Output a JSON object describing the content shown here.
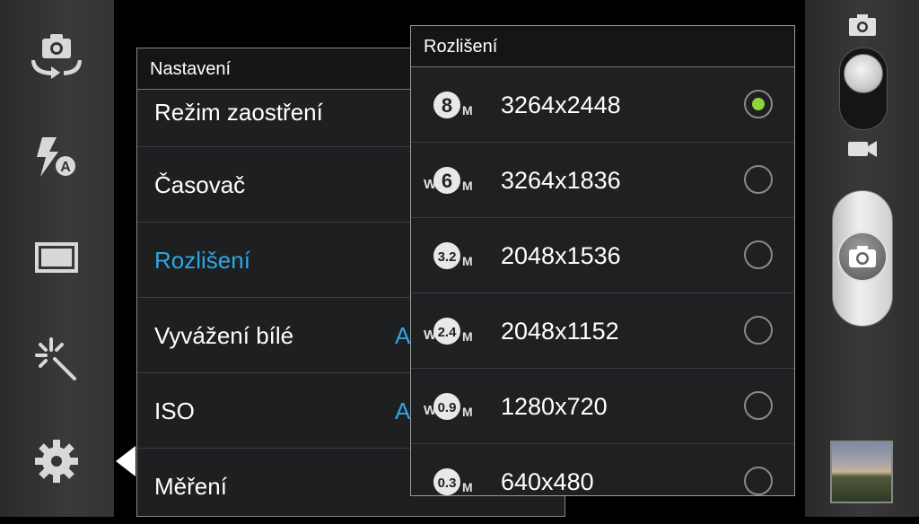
{
  "left_bar": {
    "icons": [
      "switch-camera-icon",
      "flash-auto-icon",
      "aspect-ratio-icon",
      "effects-icon",
      "gear-icon"
    ]
  },
  "settings": {
    "title": "Nastavení",
    "items": [
      {
        "label": "Režim zaostření",
        "value": ""
      },
      {
        "label": "Časovač",
        "value": ""
      },
      {
        "label": "Rozlišení",
        "value": ""
      },
      {
        "label": "Vyvážení bílé",
        "value": "A"
      },
      {
        "label": "ISO",
        "value": "A"
      },
      {
        "label": "Měření",
        "value": ""
      }
    ]
  },
  "resolution_popup": {
    "title": "Rozlišení",
    "options": [
      {
        "badge_num": "8",
        "badge_w": "",
        "label": "3264x2448",
        "selected": true
      },
      {
        "badge_num": "6",
        "badge_w": "W",
        "label": "3264x1836",
        "selected": false
      },
      {
        "badge_num": "3.2",
        "badge_w": "",
        "label": "2048x1536",
        "selected": false
      },
      {
        "badge_num": "2.4",
        "badge_w": "W",
        "label": "2048x1152",
        "selected": false
      },
      {
        "badge_num": "0.9",
        "badge_w": "W",
        "label": "1280x720",
        "selected": false
      },
      {
        "badge_num": "0.3",
        "badge_w": "",
        "label": "640x480",
        "selected": false
      }
    ],
    "badge_unit": "M",
    "selected_color": "#8fd63a"
  },
  "accent_color": "#2ea6e6",
  "right_bar": {
    "icons": [
      "camera-mode-icon",
      "video-mode-icon",
      "shutter-camera-icon"
    ]
  }
}
